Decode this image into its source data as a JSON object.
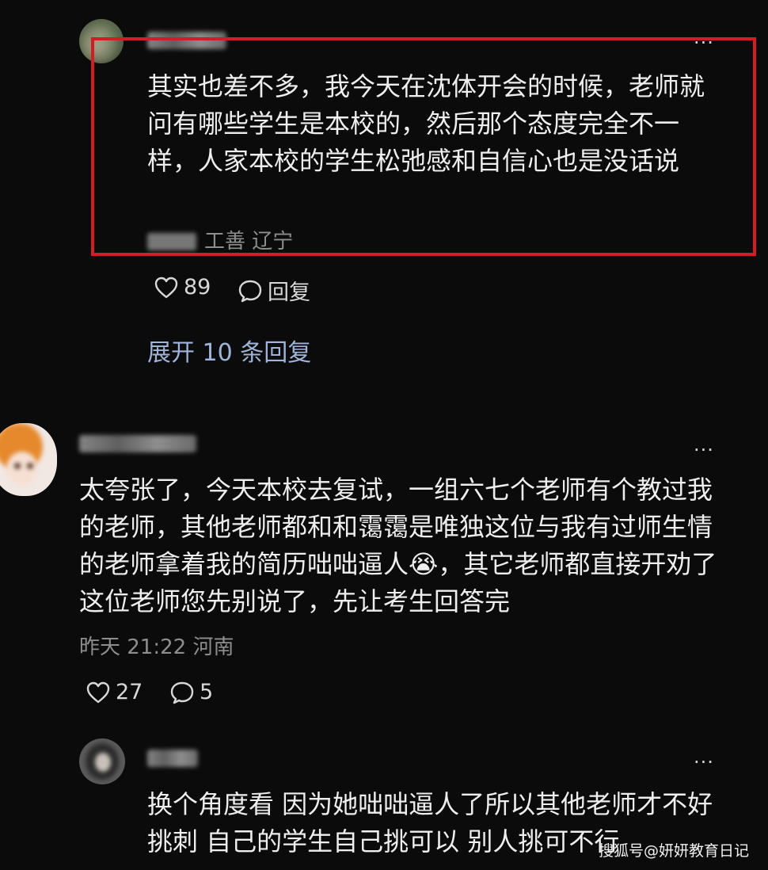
{
  "comments": [
    {
      "text": "其实也差不多，我今天在沈体开会的时候，老师就问有哪些学生是本校的，然后那个态度完全不一样，人家本校的学生松弛感和自信心也是没话说",
      "meta": "工善 辽宁",
      "likes": "89",
      "reply_label": "回复",
      "expand_label": "展开 10 条回复"
    },
    {
      "text": "太夸张了，今天本校去复试，一组六七个老师有个教过我的老师，其他老师都和和霭霭是唯独这位与我有过师生情的老师拿着我的简历咄咄逼人😭，其它老师都直接开劝了这位老师您先别说了，先让考生回答完",
      "meta": "昨天 21:22 河南",
      "likes": "27",
      "replies": "5"
    },
    {
      "text": "换个角度看 因为她咄咄逼人了所以其他老师才不好挑刺 自己的学生自己挑可以 别人挑可不行"
    }
  ],
  "more_glyph": "···",
  "watermark": "搜狐号@妍妍教育日记",
  "colors": {
    "highlight": "#d21d25",
    "link": "#9fb4d8",
    "background": "#0b0b0b"
  },
  "icons": [
    "heart-icon",
    "comment-icon",
    "more-icon"
  ]
}
